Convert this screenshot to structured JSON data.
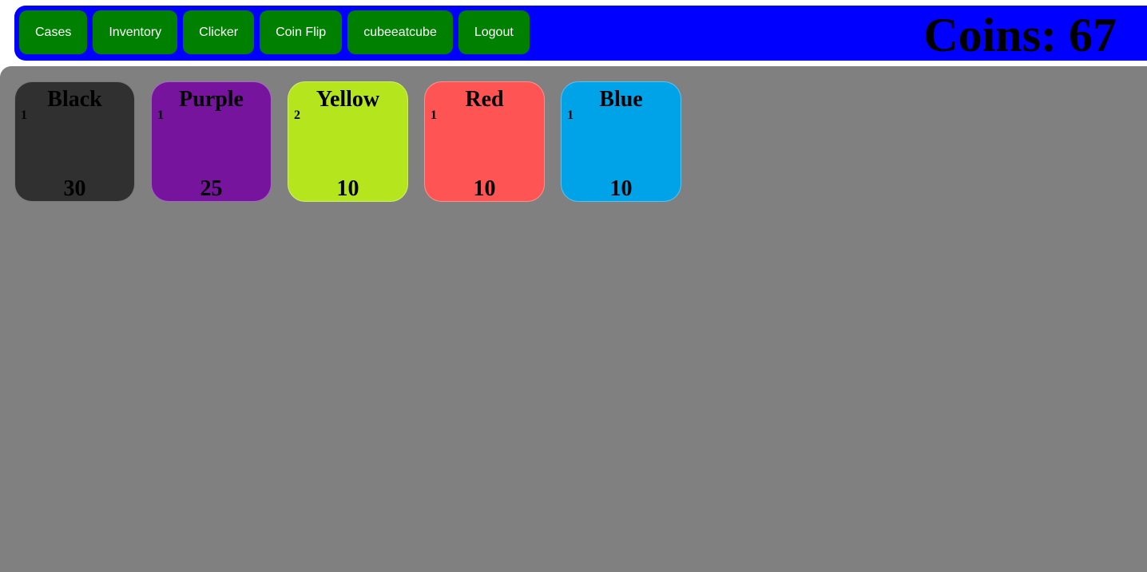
{
  "nav": {
    "items": [
      {
        "label": "Cases"
      },
      {
        "label": "Inventory"
      },
      {
        "label": "Clicker"
      },
      {
        "label": "Coin Flip"
      },
      {
        "label": "cubeeatcube"
      },
      {
        "label": "Logout"
      }
    ]
  },
  "header": {
    "coins_label": "Coins: 67"
  },
  "colors": {
    "topbar": "#0000ff",
    "nav_button": "#008000",
    "main_bg": "#808080"
  },
  "inventory": {
    "items": [
      {
        "name": "Black",
        "count": "1",
        "value": "30",
        "color": "#303030"
      },
      {
        "name": "Purple",
        "count": "1",
        "value": "25",
        "color": "#76149e"
      },
      {
        "name": "Yellow",
        "count": "2",
        "value": "10",
        "color": "#b5e61d"
      },
      {
        "name": "Red",
        "count": "1",
        "value": "10",
        "color": "#ff5454"
      },
      {
        "name": "Blue",
        "count": "1",
        "value": "10",
        "color": "#00a2e8"
      }
    ]
  }
}
